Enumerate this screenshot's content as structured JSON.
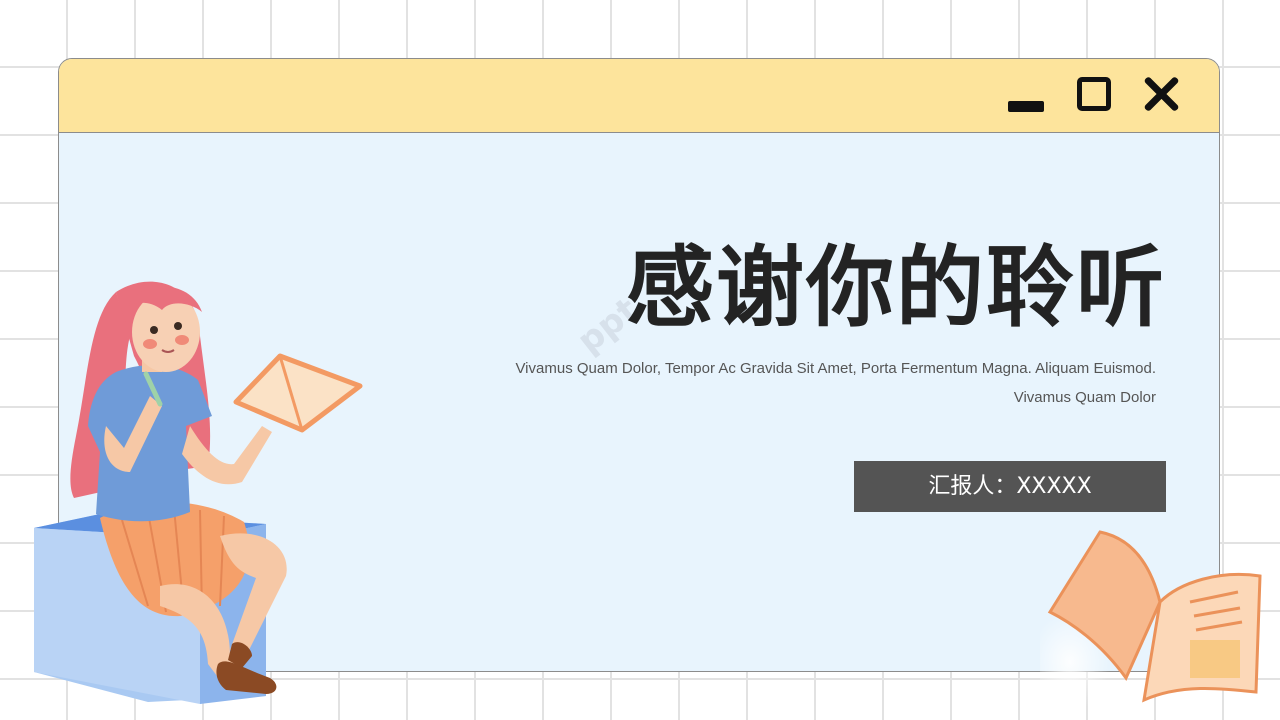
{
  "window": {
    "controls": {
      "minimize_icon": "minimize-icon",
      "maximize_icon": "maximize-icon",
      "close_icon": "close-icon"
    }
  },
  "slide": {
    "title": "感谢你的聆听",
    "subtitle": "Vivamus Quam Dolor, Tempor Ac Gravida Sit Amet, Porta Fermentum Magna. Aliquam Euismod. Vivamus Quam Dolor",
    "reporter_label": "汇报人：XXXXX",
    "watermark": "ppt"
  },
  "colors": {
    "titlebar": "#fde49c",
    "window_body": "#e8f4fd",
    "reporter_bg": "#545454",
    "title_text": "#232323"
  }
}
